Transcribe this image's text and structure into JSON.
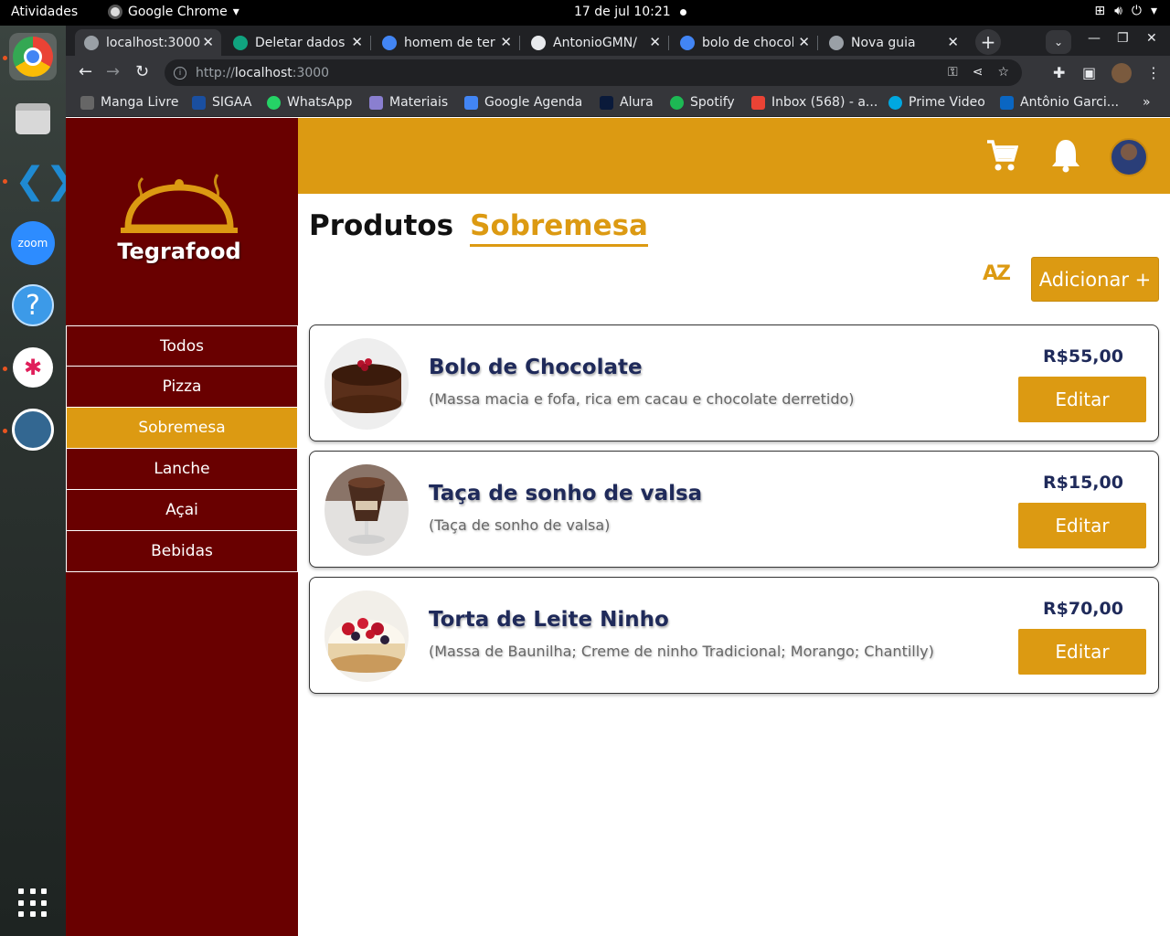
{
  "system": {
    "activities": "Atividades",
    "app_name": "Google Chrome",
    "clock": "17 de jul  10:21"
  },
  "browser": {
    "tabs": [
      {
        "title": "localhost:3000",
        "active": true,
        "favicon_color": "#9aa0a6"
      },
      {
        "title": "Deletar dados",
        "active": false,
        "favicon_color": "#10a37f"
      },
      {
        "title": "homem de terno",
        "active": false,
        "favicon_color": "#4285f4"
      },
      {
        "title": "AntonioGMN/",
        "active": false,
        "favicon_color": "#e8eaed"
      },
      {
        "title": "bolo de chocolate",
        "active": false,
        "favicon_color": "#4285f4"
      },
      {
        "title": "Nova guia",
        "active": false,
        "favicon_color": "#9aa0a6"
      }
    ],
    "url_scheme": "http://",
    "url_host": "localhost",
    "url_rest": ":3000",
    "bookmarks": [
      {
        "label": "Manga Livre",
        "color": "#666"
      },
      {
        "label": "SIGAA",
        "color": "#1a4fa0"
      },
      {
        "label": "WhatsApp",
        "color": "#25d366"
      },
      {
        "label": "Materiais",
        "color": "#8a7fd0"
      },
      {
        "label": "Google Agenda",
        "color": "#4285f4"
      },
      {
        "label": "Alura",
        "color": "#0a1a3a"
      },
      {
        "label": "Spotify",
        "color": "#1db954"
      },
      {
        "label": "Inbox (568) - a...",
        "color": "#ea4335"
      },
      {
        "label": "Prime Video",
        "color": "#00a8e1"
      },
      {
        "label": "Antônio Garci...",
        "color": "#0a66c2"
      }
    ]
  },
  "app": {
    "logo_text": "Tegrafood",
    "brand_color": "#690000",
    "accent_color": "#dc9a12",
    "menu": [
      {
        "label": "Todos",
        "active": false
      },
      {
        "label": "Pizza",
        "active": false
      },
      {
        "label": "Sobremesa",
        "active": true
      },
      {
        "label": "Lanche",
        "active": false
      },
      {
        "label": "Açai",
        "active": false
      },
      {
        "label": "Bebidas",
        "active": false
      }
    ],
    "heading_main": "Produtos",
    "heading_category": "Sobremesa",
    "sort_label": "AZ",
    "add_button": "Adicionar +",
    "products": [
      {
        "name": "Bolo de Chocolate",
        "description": "(Massa macia e fofa, rica em cacau e chocolate derretido)",
        "price": "R$55,00",
        "edit_label": "Editar",
        "image": "chocolate-cake"
      },
      {
        "name": "Taça de sonho de valsa",
        "description": "(Taça de sonho de valsa)",
        "price": "R$15,00",
        "edit_label": "Editar",
        "image": "dessert-cup"
      },
      {
        "name": "Torta de Leite Ninho",
        "description": "(Massa de Baunilha; Creme de ninho Tradicional; Morango; Chantilly)",
        "price": "R$70,00",
        "edit_label": "Editar",
        "image": "berry-pie"
      }
    ]
  }
}
